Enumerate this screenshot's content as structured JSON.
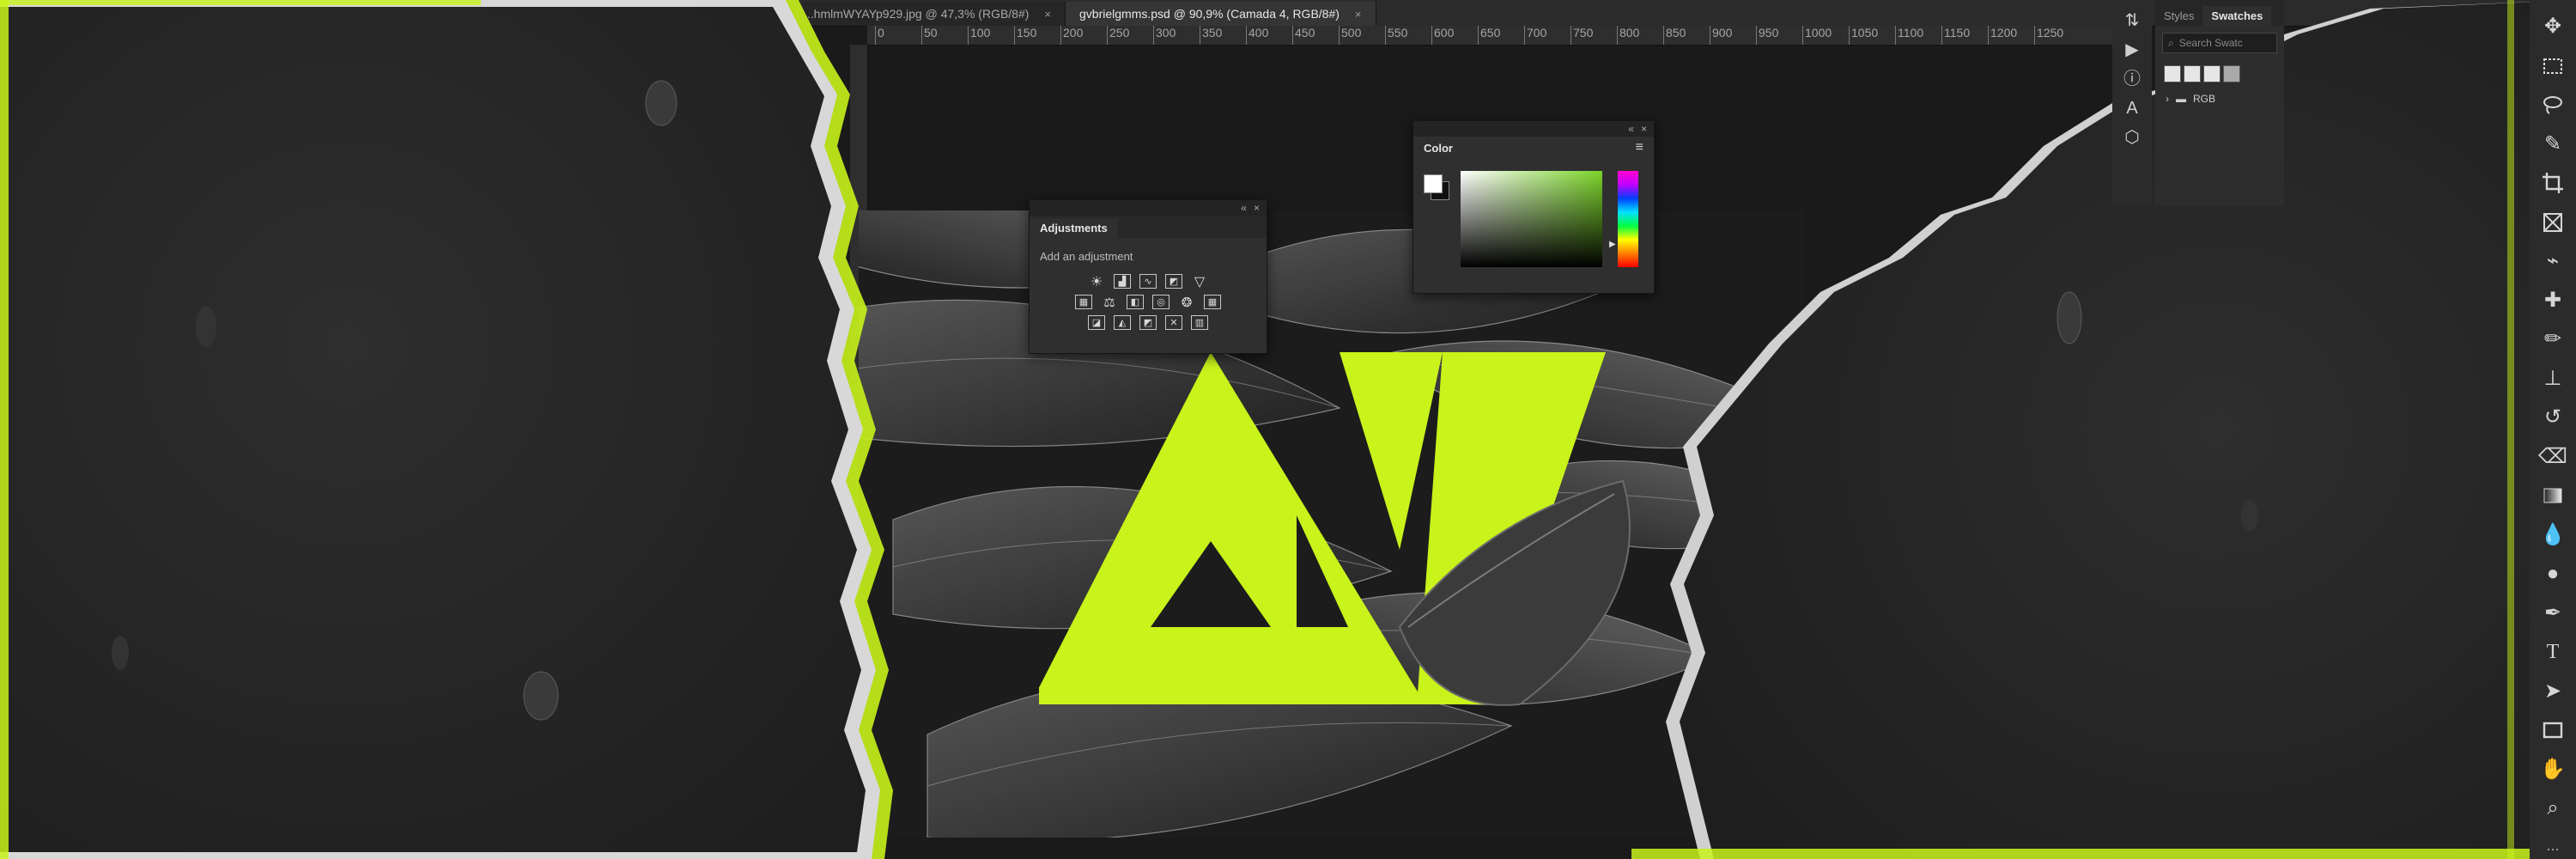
{
  "app": "Photoshop",
  "accent_color": "#c8f31b",
  "tabs": [
    {
      "label": "...hmlmWYAYp929.jpg @ 47,3% (RGB/8#)",
      "close_icon": "×",
      "active": false
    },
    {
      "label": "gvbrielgmms.psd @ 90,9% (Camada 4, RGB/8#)",
      "close_icon": "×",
      "active": true
    }
  ],
  "ruler": {
    "ticks": [
      "0",
      "50",
      "100",
      "150",
      "200",
      "250",
      "300",
      "350",
      "400",
      "450",
      "500",
      "550",
      "600",
      "650",
      "700",
      "750",
      "800",
      "850",
      "900",
      "950",
      "1000",
      "1050",
      "1100",
      "1150",
      "1200",
      "1250"
    ]
  },
  "adjustments_panel": {
    "title": "Adjustments",
    "subtitle": "Add an adjustment",
    "row1_icons": [
      "brightness-contrast-icon",
      "levels-icon",
      "curves-icon",
      "exposure-icon",
      "gradient-triangle-icon"
    ],
    "row2_icons": [
      "vibrance-icon",
      "color-balance-icon",
      "black-white-icon",
      "photo-filter-icon",
      "channel-mixer-icon",
      "color-lookup-icon"
    ],
    "row3_icons": [
      "invert-icon",
      "posterize-icon",
      "threshold-icon",
      "selective-color-icon",
      "gradient-map-icon"
    ]
  },
  "color_panel": {
    "title": "Color",
    "foreground": "#ffffff",
    "background": "#111111",
    "field_hue": "#7bd42a"
  },
  "swatches_panel": {
    "tabs": [
      "Styles",
      "Swatches"
    ],
    "search_placeholder": "Search Swatc",
    "folders": [
      "RGB"
    ]
  },
  "toolbar_icons": [
    "move-icon",
    "marquee-icon",
    "lasso-icon",
    "quick-select-icon",
    "crop-icon",
    "frame-icon",
    "eyedropper-icon",
    "healing-brush-icon",
    "brush-icon",
    "clone-stamp-icon",
    "history-brush-icon",
    "eraser-icon",
    "gradient-icon",
    "blur-icon",
    "dodge-icon",
    "pen-icon",
    "type-icon",
    "path-select-icon",
    "rectangle-icon",
    "hand-icon",
    "zoom-icon"
  ],
  "toolbar_more": "..."
}
